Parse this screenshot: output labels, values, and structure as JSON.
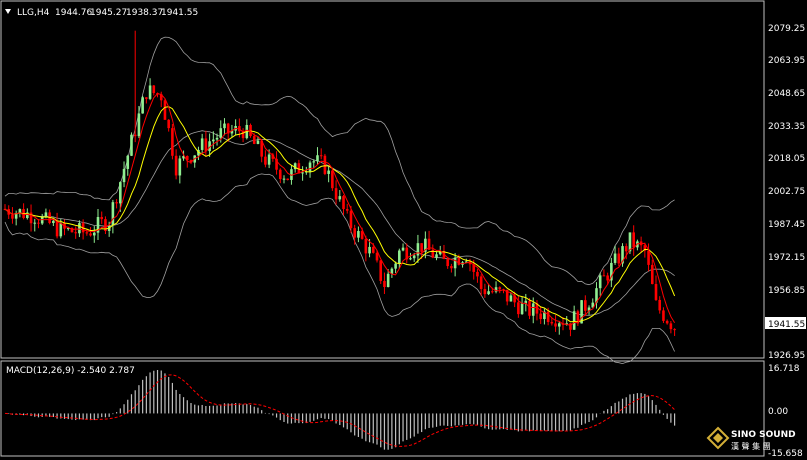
{
  "header": {
    "menu_icon": "triangle-down-icon",
    "symbol": "LLG,H4",
    "open": "1944.76",
    "high": "1945.27",
    "low": "1938.37",
    "close": "1941.55"
  },
  "price_axis": {
    "ticks": [
      "2079.25",
      "2063.95",
      "2048.65",
      "2033.35",
      "2018.05",
      "2002.75",
      "1987.45",
      "1972.15",
      "1956.85",
      "1941.55",
      "1926.95"
    ],
    "current_price": "1941.55"
  },
  "macd": {
    "label": "MACD(12,26,9) -2.540 2.787",
    "ticks": [
      "16.718",
      "0.00",
      "-15.658"
    ]
  },
  "watermark": {
    "brand": "SINO SOUND",
    "sub": "漢 聲 集 團"
  },
  "colors": {
    "bull": "#90ee90",
    "bear": "#ff0000",
    "ma_fast": "#ff0000",
    "ma_slow": "#ffff00",
    "bands": "#a0a0a0",
    "macd_hist": "#c0c0c0",
    "macd_signal": "#ff0000",
    "axis": "#c0c0c0"
  }
}
